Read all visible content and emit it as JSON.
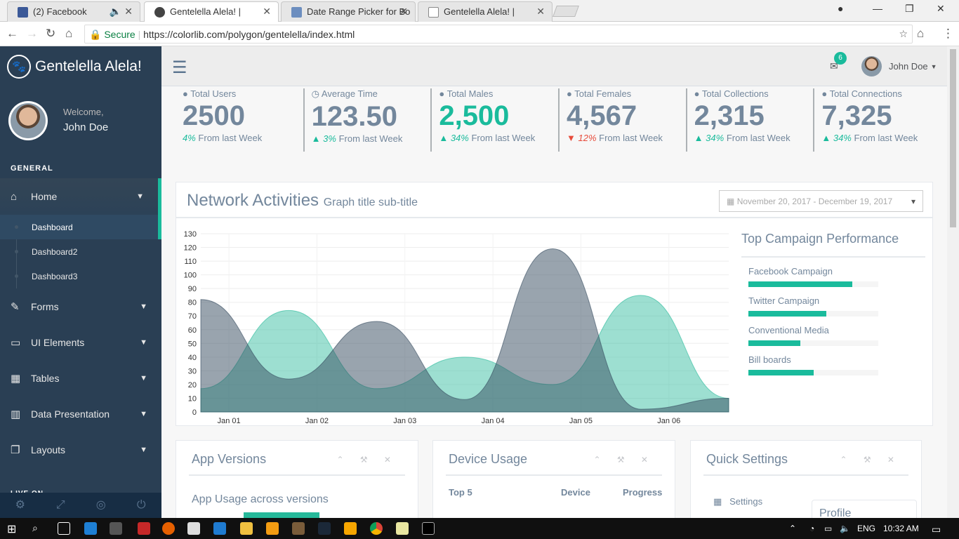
{
  "browser": {
    "tabs": [
      {
        "label": "(2) Facebook",
        "fav": "#3b5998",
        "active": false
      },
      {
        "label": "Gentelella Alela! |",
        "fav": "#444",
        "active": true
      },
      {
        "label": "Date Range Picker for Bo",
        "fav": "#6c8ebf",
        "active": false
      },
      {
        "label": "Gentelella Alela! |",
        "fav": "#888",
        "active": false
      }
    ],
    "secure": "Secure",
    "url": "https://colorlib.com/polygon/gentelella/index.html"
  },
  "sidebar": {
    "brand": "Gentelella Alela!",
    "welcome": "Welcome,",
    "user": "John Doe",
    "section": "GENERAL",
    "live": "LIVE ON",
    "items": [
      {
        "label": "Home",
        "icon": "home-icon"
      },
      {
        "label": "Forms",
        "icon": "edit-icon"
      },
      {
        "label": "UI Elements",
        "icon": "desktop-icon"
      },
      {
        "label": "Tables",
        "icon": "table-icon"
      },
      {
        "label": "Data Presentation",
        "icon": "bar-chart-icon"
      },
      {
        "label": "Layouts",
        "icon": "clone-icon"
      }
    ],
    "sub": [
      "Dashboard",
      "Dashboard2",
      "Dashboard3"
    ]
  },
  "topnav": {
    "badge": "6",
    "user": "John Doe"
  },
  "tiles": [
    {
      "title": "Total Users",
      "count": "2500",
      "pct": "4%",
      "text": "From last Week",
      "dir": "none",
      "green": false
    },
    {
      "title": "Average Time",
      "count": "123.50",
      "pct": "3%",
      "text": "From last Week",
      "dir": "up",
      "green": false
    },
    {
      "title": "Total Males",
      "count": "2,500",
      "pct": "34%",
      "text": "From last Week",
      "dir": "up",
      "green": true
    },
    {
      "title": "Total Females",
      "count": "4,567",
      "pct": "12%",
      "text": "From last Week",
      "dir": "down",
      "green": false
    },
    {
      "title": "Total Collections",
      "count": "2,315",
      "pct": "34%",
      "text": "From last Week",
      "dir": "up",
      "green": false
    },
    {
      "title": "Total Connections",
      "count": "7,325",
      "pct": "34%",
      "text": "From last Week",
      "dir": "up",
      "green": false
    }
  ],
  "network": {
    "title": "Network Activities",
    "subtitle": "Graph title sub-title",
    "daterange": "November 20, 2017 - December 19, 2017"
  },
  "chart_data": {
    "type": "area",
    "categories": [
      "Jan 01",
      "Jan 02",
      "Jan 03",
      "Jan 04",
      "Jan 05",
      "Jan 06"
    ],
    "ylim": [
      0,
      130
    ],
    "yticks": [
      0,
      10,
      20,
      30,
      40,
      50,
      60,
      70,
      80,
      90,
      100,
      110,
      120,
      130
    ],
    "series": [
      {
        "color": "#26b99a",
        "x": [
          0,
          1,
          2,
          3,
          4,
          5,
          6
        ],
        "values": [
          17,
          74,
          17,
          40,
          20,
          85,
          10
        ]
      },
      {
        "color": "#34495e",
        "x": [
          0,
          1,
          2,
          3,
          4,
          5,
          6
        ],
        "values": [
          82,
          24,
          66,
          9,
          119,
          2,
          10
        ]
      }
    ]
  },
  "campaign": {
    "title": "Top Campaign Performance",
    "rows": [
      {
        "label": "Facebook Campaign",
        "pct": 80
      },
      {
        "label": "Twitter Campaign",
        "pct": 60
      },
      {
        "label": "Conventional Media",
        "pct": 40
      },
      {
        "label": "Bill boards",
        "pct": 50
      }
    ]
  },
  "cards": [
    {
      "title": "App Versions"
    },
    {
      "title": "Device Usage"
    },
    {
      "title": "Quick Settings"
    }
  ],
  "cards_extra": {
    "app_usage": "App Usage across versions",
    "device_cols": [
      "Top 5",
      "Device",
      "Progress"
    ],
    "settings": "Settings",
    "profile_completion": "Profile Completion"
  },
  "taskbar": {
    "lang": "ENG",
    "time": "10:32 AM"
  }
}
